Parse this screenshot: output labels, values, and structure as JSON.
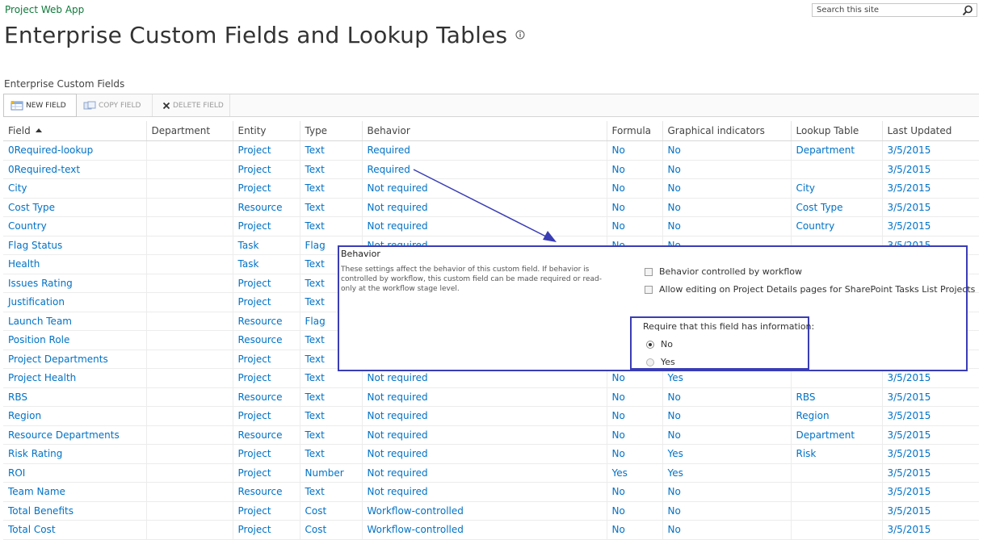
{
  "app": {
    "name": "Project Web App"
  },
  "search": {
    "placeholder": "Search this site"
  },
  "page": {
    "title": "Enterprise Custom Fields and Lookup Tables",
    "section": "Enterprise Custom Fields"
  },
  "toolbar": {
    "new_field": "NEW FIELD",
    "copy_field": "COPY FIELD",
    "delete_field": "DELETE FIELD"
  },
  "table": {
    "columns": [
      "Field",
      "Department",
      "Entity",
      "Type",
      "Behavior",
      "Formula",
      "Graphical indicators",
      "Lookup Table",
      "Last Updated"
    ],
    "rows": [
      [
        "0Required-lookup",
        "",
        "Project",
        "Text",
        "Required",
        "No",
        "No",
        "Department",
        "3/5/2015"
      ],
      [
        "0Required-text",
        "",
        "Project",
        "Text",
        "Required",
        "No",
        "No",
        "",
        "3/5/2015"
      ],
      [
        "City",
        "",
        "Project",
        "Text",
        "Not required",
        "No",
        "No",
        "City",
        "3/5/2015"
      ],
      [
        "Cost Type",
        "",
        "Resource",
        "Text",
        "Not required",
        "No",
        "No",
        "Cost Type",
        "3/5/2015"
      ],
      [
        "Country",
        "",
        "Project",
        "Text",
        "Not required",
        "No",
        "No",
        "Country",
        "3/5/2015"
      ],
      [
        "Flag Status",
        "",
        "Task",
        "Flag",
        "Not required",
        "No",
        "No",
        "",
        "3/5/2015"
      ],
      [
        "Health",
        "",
        "Task",
        "Text",
        "",
        "",
        "",
        "",
        ""
      ],
      [
        "Issues Rating",
        "",
        "Project",
        "Text",
        "",
        "",
        "",
        "",
        ""
      ],
      [
        "Justification",
        "",
        "Project",
        "Text",
        "",
        "",
        "",
        "",
        ""
      ],
      [
        "Launch Team",
        "",
        "Resource",
        "Flag",
        "",
        "",
        "",
        "",
        ""
      ],
      [
        "Position Role",
        "",
        "Resource",
        "Text",
        "",
        "",
        "",
        "",
        ""
      ],
      [
        "Project Departments",
        "",
        "Project",
        "Text",
        "",
        "",
        "",
        "",
        ""
      ],
      [
        "Project Health",
        "",
        "Project",
        "Text",
        "Not required",
        "No",
        "Yes",
        "",
        "3/5/2015"
      ],
      [
        "RBS",
        "",
        "Resource",
        "Text",
        "Not required",
        "No",
        "No",
        "RBS",
        "3/5/2015"
      ],
      [
        "Region",
        "",
        "Project",
        "Text",
        "Not required",
        "No",
        "No",
        "Region",
        "3/5/2015"
      ],
      [
        "Resource Departments",
        "",
        "Resource",
        "Text",
        "Not required",
        "No",
        "No",
        "Department",
        "3/5/2015"
      ],
      [
        "Risk Rating",
        "",
        "Project",
        "Text",
        "Not required",
        "No",
        "Yes",
        "Risk",
        "3/5/2015"
      ],
      [
        "ROI",
        "",
        "Project",
        "Number",
        "Not required",
        "Yes",
        "Yes",
        "",
        "3/5/2015"
      ],
      [
        "Team Name",
        "",
        "Resource",
        "Text",
        "Not required",
        "No",
        "No",
        "",
        "3/5/2015"
      ],
      [
        "Total Benefits",
        "",
        "Project",
        "Cost",
        "Workflow-controlled",
        "No",
        "No",
        "",
        "3/5/2015"
      ],
      [
        "Total Cost",
        "",
        "Project",
        "Cost",
        "Workflow-controlled",
        "No",
        "No",
        "",
        "3/5/2015"
      ]
    ]
  },
  "behavior_panel": {
    "title": "Behavior",
    "description": "These settings affect the behavior of this custom field. If behavior is controlled by workflow, this custom field can be made required or read-only at the workflow stage level.",
    "checkbox_workflow": "Behavior controlled by workflow",
    "checkbox_editing": "Allow editing on Project Details pages for SharePoint Tasks List Projects",
    "require_title": "Require that this field has information:",
    "option_no": "No",
    "option_yes": "Yes",
    "selected": "No"
  },
  "colors": {
    "link": "#0072c6",
    "app_name": "#0f7a3a",
    "annotation": "#3a3db5"
  },
  "icons": {
    "search": "search-icon",
    "info": "info-icon",
    "new": "new-field-icon",
    "copy": "copy-field-icon",
    "delete": "delete-x-icon",
    "sort": "sort-ascending-icon"
  }
}
